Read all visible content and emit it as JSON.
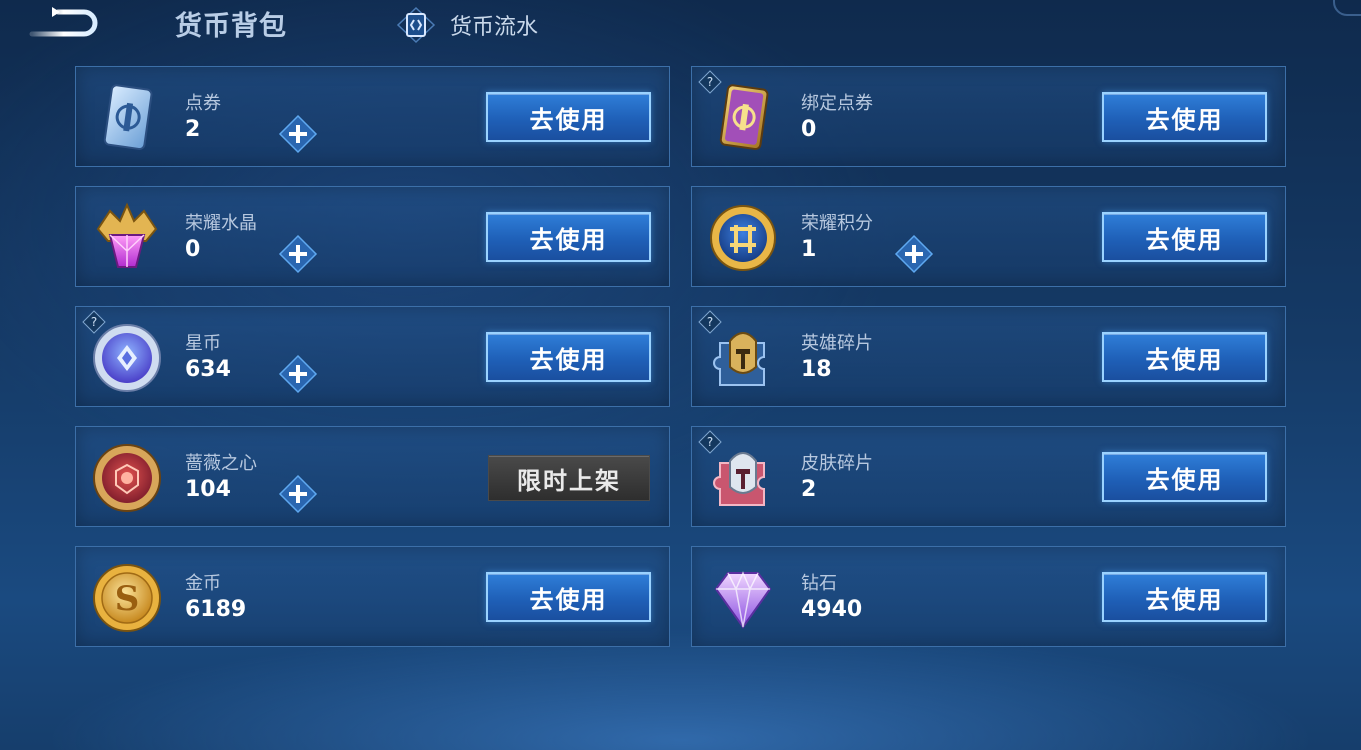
{
  "header": {
    "title": "货币背包",
    "flow_tab_label": "货币流水"
  },
  "items": [
    {
      "name": "点券",
      "value": "2",
      "button": "去使用",
      "icon": "coupon-icon",
      "plus": true,
      "help": false
    },
    {
      "name": "绑定点券",
      "value": "0",
      "button": "去使用",
      "icon": "bound-coupon-icon",
      "plus": false,
      "help": true
    },
    {
      "name": "荣耀水晶",
      "value": "0",
      "button": "去使用",
      "icon": "glory-crystal-icon",
      "plus": true,
      "help": false
    },
    {
      "name": "荣耀积分",
      "value": "1",
      "button": "去使用",
      "icon": "glory-points-icon",
      "plus": true,
      "help": false
    },
    {
      "name": "星币",
      "value": "634",
      "button": "去使用",
      "icon": "star-coin-icon",
      "plus": true,
      "help": true
    },
    {
      "name": "英雄碎片",
      "value": "18",
      "button": "去使用",
      "icon": "hero-fragment-icon",
      "plus": false,
      "help": true
    },
    {
      "name": "蔷薇之心",
      "value": "104",
      "button": "限时上架",
      "icon": "rose-heart-icon",
      "plus": true,
      "help": false
    },
    {
      "name": "皮肤碎片",
      "value": "2",
      "button": "去使用",
      "icon": "skin-fragment-icon",
      "plus": false,
      "help": true
    },
    {
      "name": "金币",
      "value": "6189",
      "button": "去使用",
      "icon": "gold-coin-icon",
      "plus": false,
      "help": false
    },
    {
      "name": "钻石",
      "value": "4940",
      "button": "去使用",
      "icon": "diamond-icon",
      "plus": false,
      "help": false
    }
  ],
  "colors": {
    "button_blue": "#2f7ed8",
    "button_border": "#9ad2ff",
    "card_border": "#3c6fa8",
    "limited_button": "#3a3a3a"
  }
}
